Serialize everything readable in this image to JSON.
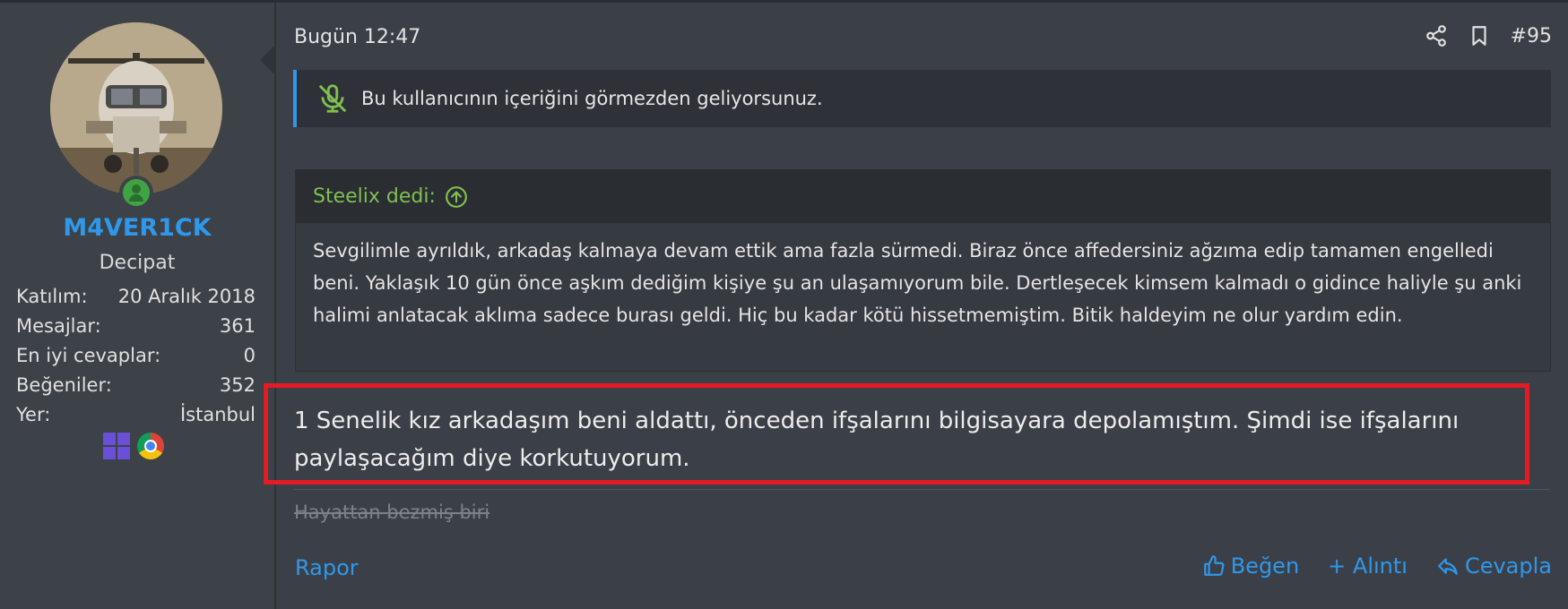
{
  "user": {
    "username": "M4VER1CK",
    "title": "Decipat",
    "stats": [
      {
        "label": "Katılım:",
        "value": "20 Aralık 2018"
      },
      {
        "label": "Mesajlar:",
        "value": "361"
      },
      {
        "label": "En iyi cevaplar:",
        "value": "0"
      },
      {
        "label": "Beğeniler:",
        "value": "352"
      },
      {
        "label": "Yer:",
        "value": "İstanbul"
      }
    ],
    "badges": [
      "windows-icon",
      "chrome-icon"
    ],
    "status": "online"
  },
  "post": {
    "date": "Bugün 12:47",
    "number": "#95",
    "ignored_notice": "Bu kullanıcının içeriğini görmezden geliyorsunuz.",
    "quote": {
      "header": "Steelix dedi:",
      "text": "Sevgilimle ayrıldık, arkadaş kalmaya devam ettik ama fazla sürmedi. Biraz önce affedersiniz ağzıma edip tamamen engelledi beni. Yaklaşık 10 gün önce aşkım dediğim kişiye şu an ulaşamıyorum bile. Dertleşecek kimsem kalmadı o gidince haliyle şu anki halimi anlatacak aklıma sadece burası geldi. Hiç bu kadar kötü hissetmemiştim. Bitik haldeyim ne olur yardım edin."
    },
    "message": "1 Senelik kız arkadaşım beni aldattı, önceden ifşalarını bilgisayara depolamıştım. Şimdi ise ifşalarını paylaşacağım diye korkutuyorum.",
    "signature": "Hayattan bezmiş biri"
  },
  "actions": {
    "report": "Rapor",
    "like": "Beğen",
    "quote": "+ Alıntı",
    "reply": "Cevapla"
  },
  "colors": {
    "accent": "#2f98ea",
    "quote_author": "#7ec14f",
    "highlight_border": "#e51b24",
    "online": "#3fa344"
  }
}
